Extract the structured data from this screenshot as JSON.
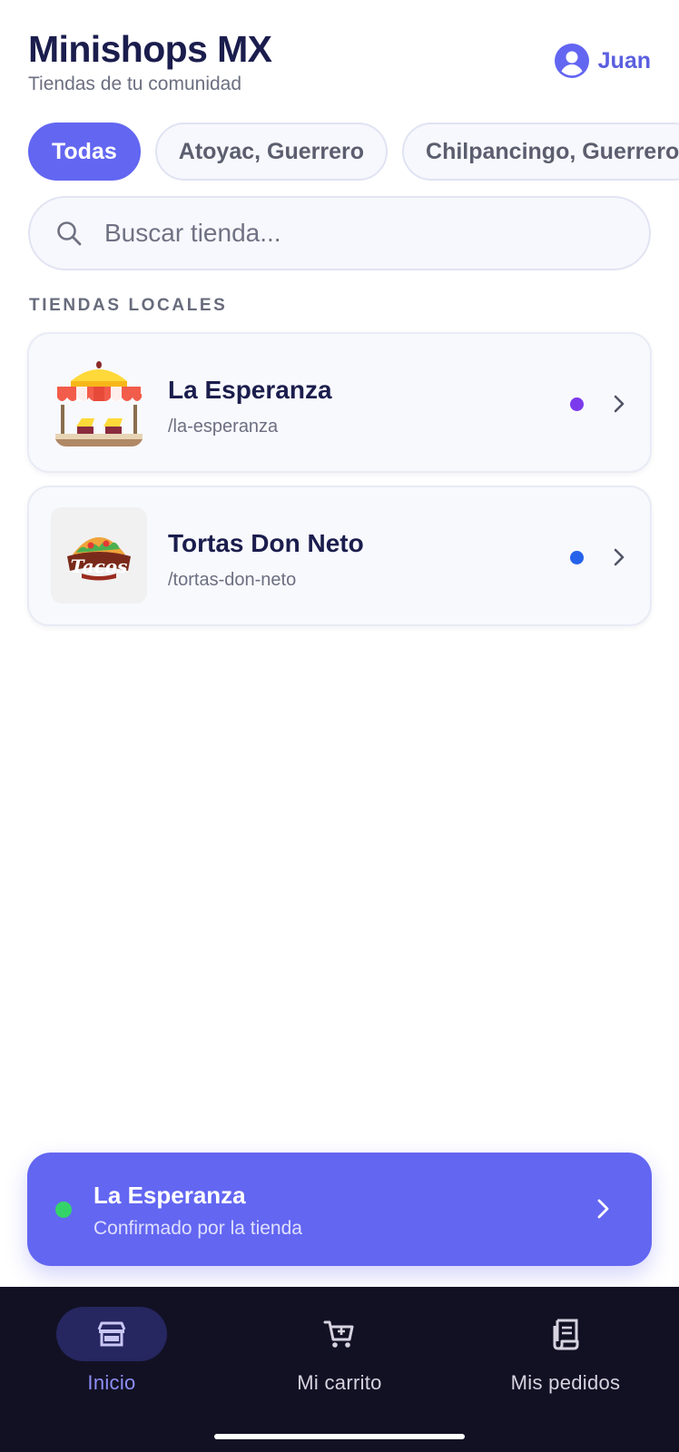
{
  "app": {
    "title": "Minishops MX",
    "subtitle": "Tiendas de tu comunidad",
    "user_name": "Juan",
    "accent_color": "#6366f1"
  },
  "filters": [
    {
      "label": "Todas",
      "active": true
    },
    {
      "label": "Atoyac, Guerrero",
      "active": false
    },
    {
      "label": "Chilpancingo, Guerrero",
      "active": false
    }
  ],
  "search": {
    "placeholder": "Buscar tienda...",
    "value": ""
  },
  "section": {
    "label": "TIENDAS LOCALES"
  },
  "stores": [
    {
      "name": "La Esperanza",
      "slug": "/la-esperanza",
      "logo": "market-stall-icon",
      "dot_color": "#7c3aed"
    },
    {
      "name": "Tortas Don Neto",
      "slug": "/tortas-don-neto",
      "logo": "tacos-logo",
      "logo_text": "Tacos",
      "dot_color": "#2563eb"
    }
  ],
  "order_banner": {
    "store": "La Esperanza",
    "status": "Confirmado por la tienda",
    "status_color": "#34d36a"
  },
  "nav": [
    {
      "label": "Inicio",
      "icon": "store-icon",
      "active": true
    },
    {
      "label": "Mi carrito",
      "icon": "cart-icon",
      "active": false
    },
    {
      "label": "Mis pedidos",
      "icon": "receipt-icon",
      "active": false
    }
  ]
}
